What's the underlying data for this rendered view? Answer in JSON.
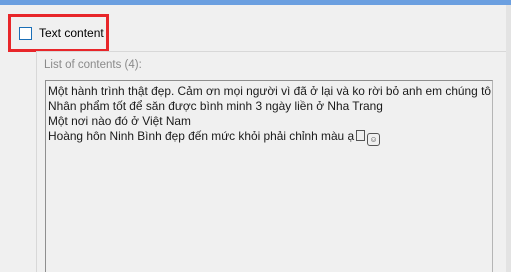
{
  "checkbox": {
    "label": "Text content",
    "checked": false
  },
  "list": {
    "title": "List of contents (4):",
    "items": [
      "Một hành trình thật đẹp. Cảm ơn mọi người vì đã ở lại và ko rời bỏ anh em chúng tô",
      "Nhân phẩm tốt để săn được bình minh 3 ngày liền ở Nha Trang",
      "Một nơi nào đó ở Việt Nam",
      "Hoàng hôn Ninh Bình đẹp đến mức khỏi phải chỉnh màu ạ"
    ],
    "last_item_icons": [
      "unknown-glyph-icon",
      "emoji-face-icon"
    ]
  },
  "colors": {
    "highlight_border": "#e8262a",
    "checkbox_border": "#1b6fb7",
    "top_bar": "#6b9fe0"
  }
}
